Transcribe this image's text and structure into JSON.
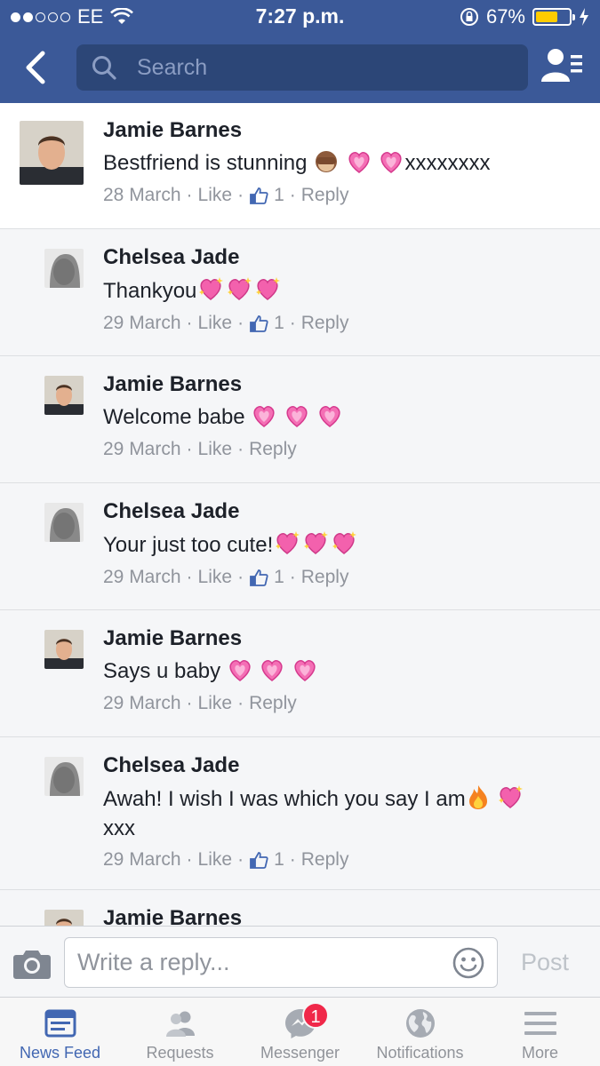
{
  "status_bar": {
    "carrier": "EE",
    "time": "7:27 p.m.",
    "battery": "67%",
    "battery_level": 0.67
  },
  "header": {
    "search_placeholder": "Search"
  },
  "comments": [
    {
      "author": "Jamie Barnes",
      "text": "Bestfriend is stunning",
      "text_suffix": "xxxxxxxx",
      "emoji": [
        "see-no-evil-monkey",
        "pink-heart",
        "pink-heart"
      ],
      "date": "28 March",
      "like_label": "Like",
      "likes": "1",
      "reply_label": "Reply"
    },
    {
      "author": "Chelsea Jade",
      "text": "Thankyou",
      "emoji": [
        "sparkling-heart",
        "sparkling-heart",
        "sparkling-heart"
      ],
      "date": "29 March",
      "like_label": "Like",
      "likes": "1",
      "reply_label": "Reply"
    },
    {
      "author": "Jamie Barnes",
      "text": "Welcome babe",
      "emoji": [
        "pink-heart",
        "pink-heart",
        "pink-heart"
      ],
      "date": "29 March",
      "like_label": "Like",
      "reply_label": "Reply"
    },
    {
      "author": "Chelsea Jade",
      "text": "Your just too cute!",
      "emoji": [
        "sparkling-heart",
        "sparkling-heart",
        "sparkling-heart"
      ],
      "date": "29 March",
      "like_label": "Like",
      "likes": "1",
      "reply_label": "Reply"
    },
    {
      "author": "Jamie Barnes",
      "text": "Says u baby",
      "emoji": [
        "pink-heart",
        "pink-heart",
        "pink-heart"
      ],
      "date": "29 March",
      "like_label": "Like",
      "reply_label": "Reply"
    },
    {
      "author": "Chelsea Jade",
      "text": "Awah! I wish I was which you say I am",
      "text_line2": "xxx",
      "emoji": [
        "fire",
        "sparkling-heart"
      ],
      "date": "29 March",
      "like_label": "Like",
      "likes": "1",
      "reply_label": "Reply"
    },
    {
      "author": "Jamie Barnes"
    }
  ],
  "reply_bar": {
    "placeholder": "Write a reply...",
    "post_label": "Post"
  },
  "tabs": [
    {
      "label": "News Feed",
      "icon": "news-feed-icon",
      "active": true
    },
    {
      "label": "Requests",
      "icon": "requests-icon"
    },
    {
      "label": "Messenger",
      "icon": "messenger-icon",
      "badge": "1"
    },
    {
      "label": "Notifications",
      "icon": "globe-icon"
    },
    {
      "label": "More",
      "icon": "menu-icon"
    }
  ],
  "colors": {
    "header": "#3b5998",
    "search": "#2c4677",
    "active_tab": "#4267b2",
    "badge": "#f02849"
  }
}
